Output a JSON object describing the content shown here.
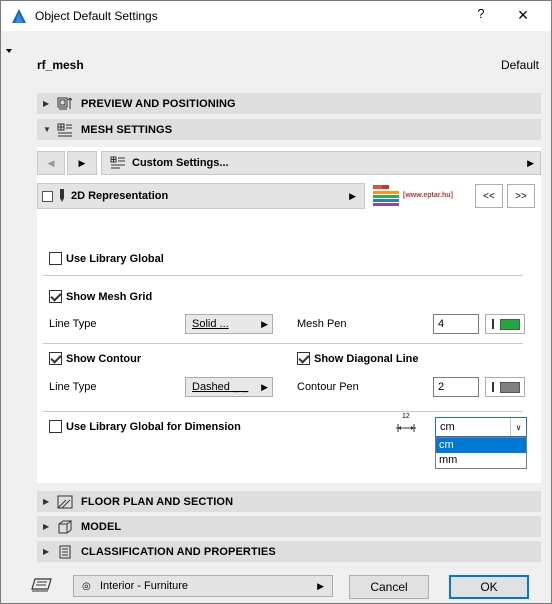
{
  "window": {
    "title": "Object Default Settings",
    "help_label": "?",
    "close_label": "×"
  },
  "header": {
    "object_name": "rf_mesh",
    "default_label": "Default"
  },
  "sections": {
    "preview": "PREVIEW AND POSITIONING",
    "mesh": "MESH SETTINGS",
    "floor_plan": "FLOOR PLAN AND SECTION",
    "model": "MODEL",
    "classification": "CLASSIFICATION AND PROPERTIES"
  },
  "nav": {
    "custom_settings": "Custom Settings..."
  },
  "representation": {
    "label": "2D Representation",
    "logo_text": "[www.eptar.hu]",
    "prev_label": "<<",
    "next_label": ">>"
  },
  "settings": {
    "use_library_global": {
      "label": "Use Library Global",
      "checked": false
    },
    "show_mesh_grid": {
      "label": "Show Mesh Grid",
      "checked": true
    },
    "line_type_label_1": "Line Type",
    "line_type_value_1": "Solid ...",
    "mesh_pen_label": "Mesh Pen",
    "mesh_pen_value": "4",
    "mesh_pen_color": "#1fa83c",
    "show_contour": {
      "label": "Show Contour",
      "checked": true
    },
    "show_diagonal_line": {
      "label": "Show Diagonal Line",
      "checked": true
    },
    "line_type_label_2": "Line Type",
    "line_type_value_2": "Dashed _ _",
    "contour_pen_label": "Contour Pen",
    "contour_pen_value": "2",
    "contour_pen_color": "#808080",
    "use_library_global_dimension": {
      "label": "Use Library Global for Dimension",
      "checked": false
    },
    "unit_selected": "cm",
    "unit_options": [
      "cm",
      "mm"
    ],
    "dimension_icon_text": "12"
  },
  "footer": {
    "layer_value": "Interior - Furniture",
    "cancel_label": "Cancel",
    "ok_label": "OK"
  }
}
